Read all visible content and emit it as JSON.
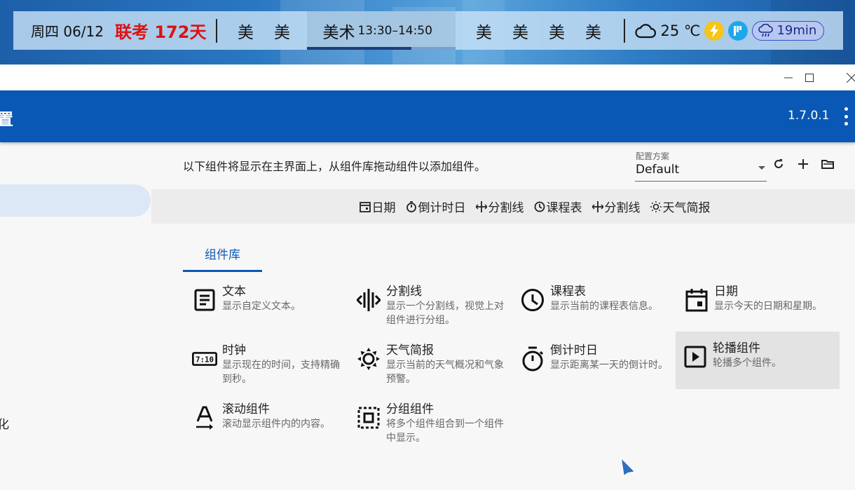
{
  "topbar": {
    "date": "周四 06/12",
    "exam_countdown": "联考 172天",
    "classes_before": [
      "美",
      "美"
    ],
    "current_class": {
      "name": "美术",
      "time": "13:30–14:50",
      "progress": 0.7
    },
    "classes_after": [
      "美",
      "美",
      "美",
      "美"
    ],
    "weather": {
      "icon": "cloud-icon",
      "temp": "25 ℃"
    },
    "alert_colors": [
      "#f5c518",
      "#1ea7e8"
    ],
    "rain_forecast": "19min"
  },
  "window": {
    "title_fragment": "置",
    "version": "1.7.0.1",
    "sidebar_fragment": "化"
  },
  "content": {
    "description": "以下组件将显示在主界面上，从组件库拖动组件以添加组件。",
    "profile": {
      "label": "配置方案",
      "value": "Default"
    },
    "preview": [
      {
        "icon": "calendar-icon",
        "label": "日期"
      },
      {
        "icon": "timer-icon",
        "label": "倒计时日"
      },
      {
        "icon": "divider-icon",
        "label": "分割线"
      },
      {
        "icon": "clock-icon",
        "label": "课程表"
      },
      {
        "icon": "divider-icon",
        "label": "分割线"
      },
      {
        "icon": "weather-icon",
        "label": "天气简报"
      }
    ],
    "tab": "组件库",
    "components": [
      {
        "icon": "text-icon",
        "name": "文本",
        "desc": "显示自定义文本。"
      },
      {
        "icon": "divider-icon",
        "name": "分割线",
        "desc": "显示一个分割线，视觉上对组件进行分组。"
      },
      {
        "icon": "clock-icon",
        "name": "课程表",
        "desc": "显示当前的课程表信息。"
      },
      {
        "icon": "calendar-icon",
        "name": "日期",
        "desc": "显示今天的日期和星期。"
      },
      {
        "icon": "digital-clock-icon",
        "name": "时钟",
        "desc": "显示现在的时间，支持精确到秒。"
      },
      {
        "icon": "weather-icon",
        "name": "天气简报",
        "desc": "显示当前的天气概况和气象预警。"
      },
      {
        "icon": "timer-icon",
        "name": "倒计时日",
        "desc": "显示距离某一天的倒计时。"
      },
      {
        "icon": "slideshow-icon",
        "name": "轮播组件",
        "desc": "轮播多个组件。"
      },
      {
        "icon": "marquee-icon",
        "name": "滚动组件",
        "desc": "滚动显示组件内的内容。"
      },
      {
        "icon": "group-icon",
        "name": "分组组件",
        "desc": "将多个组件组合到一个组件中显示。"
      }
    ]
  }
}
